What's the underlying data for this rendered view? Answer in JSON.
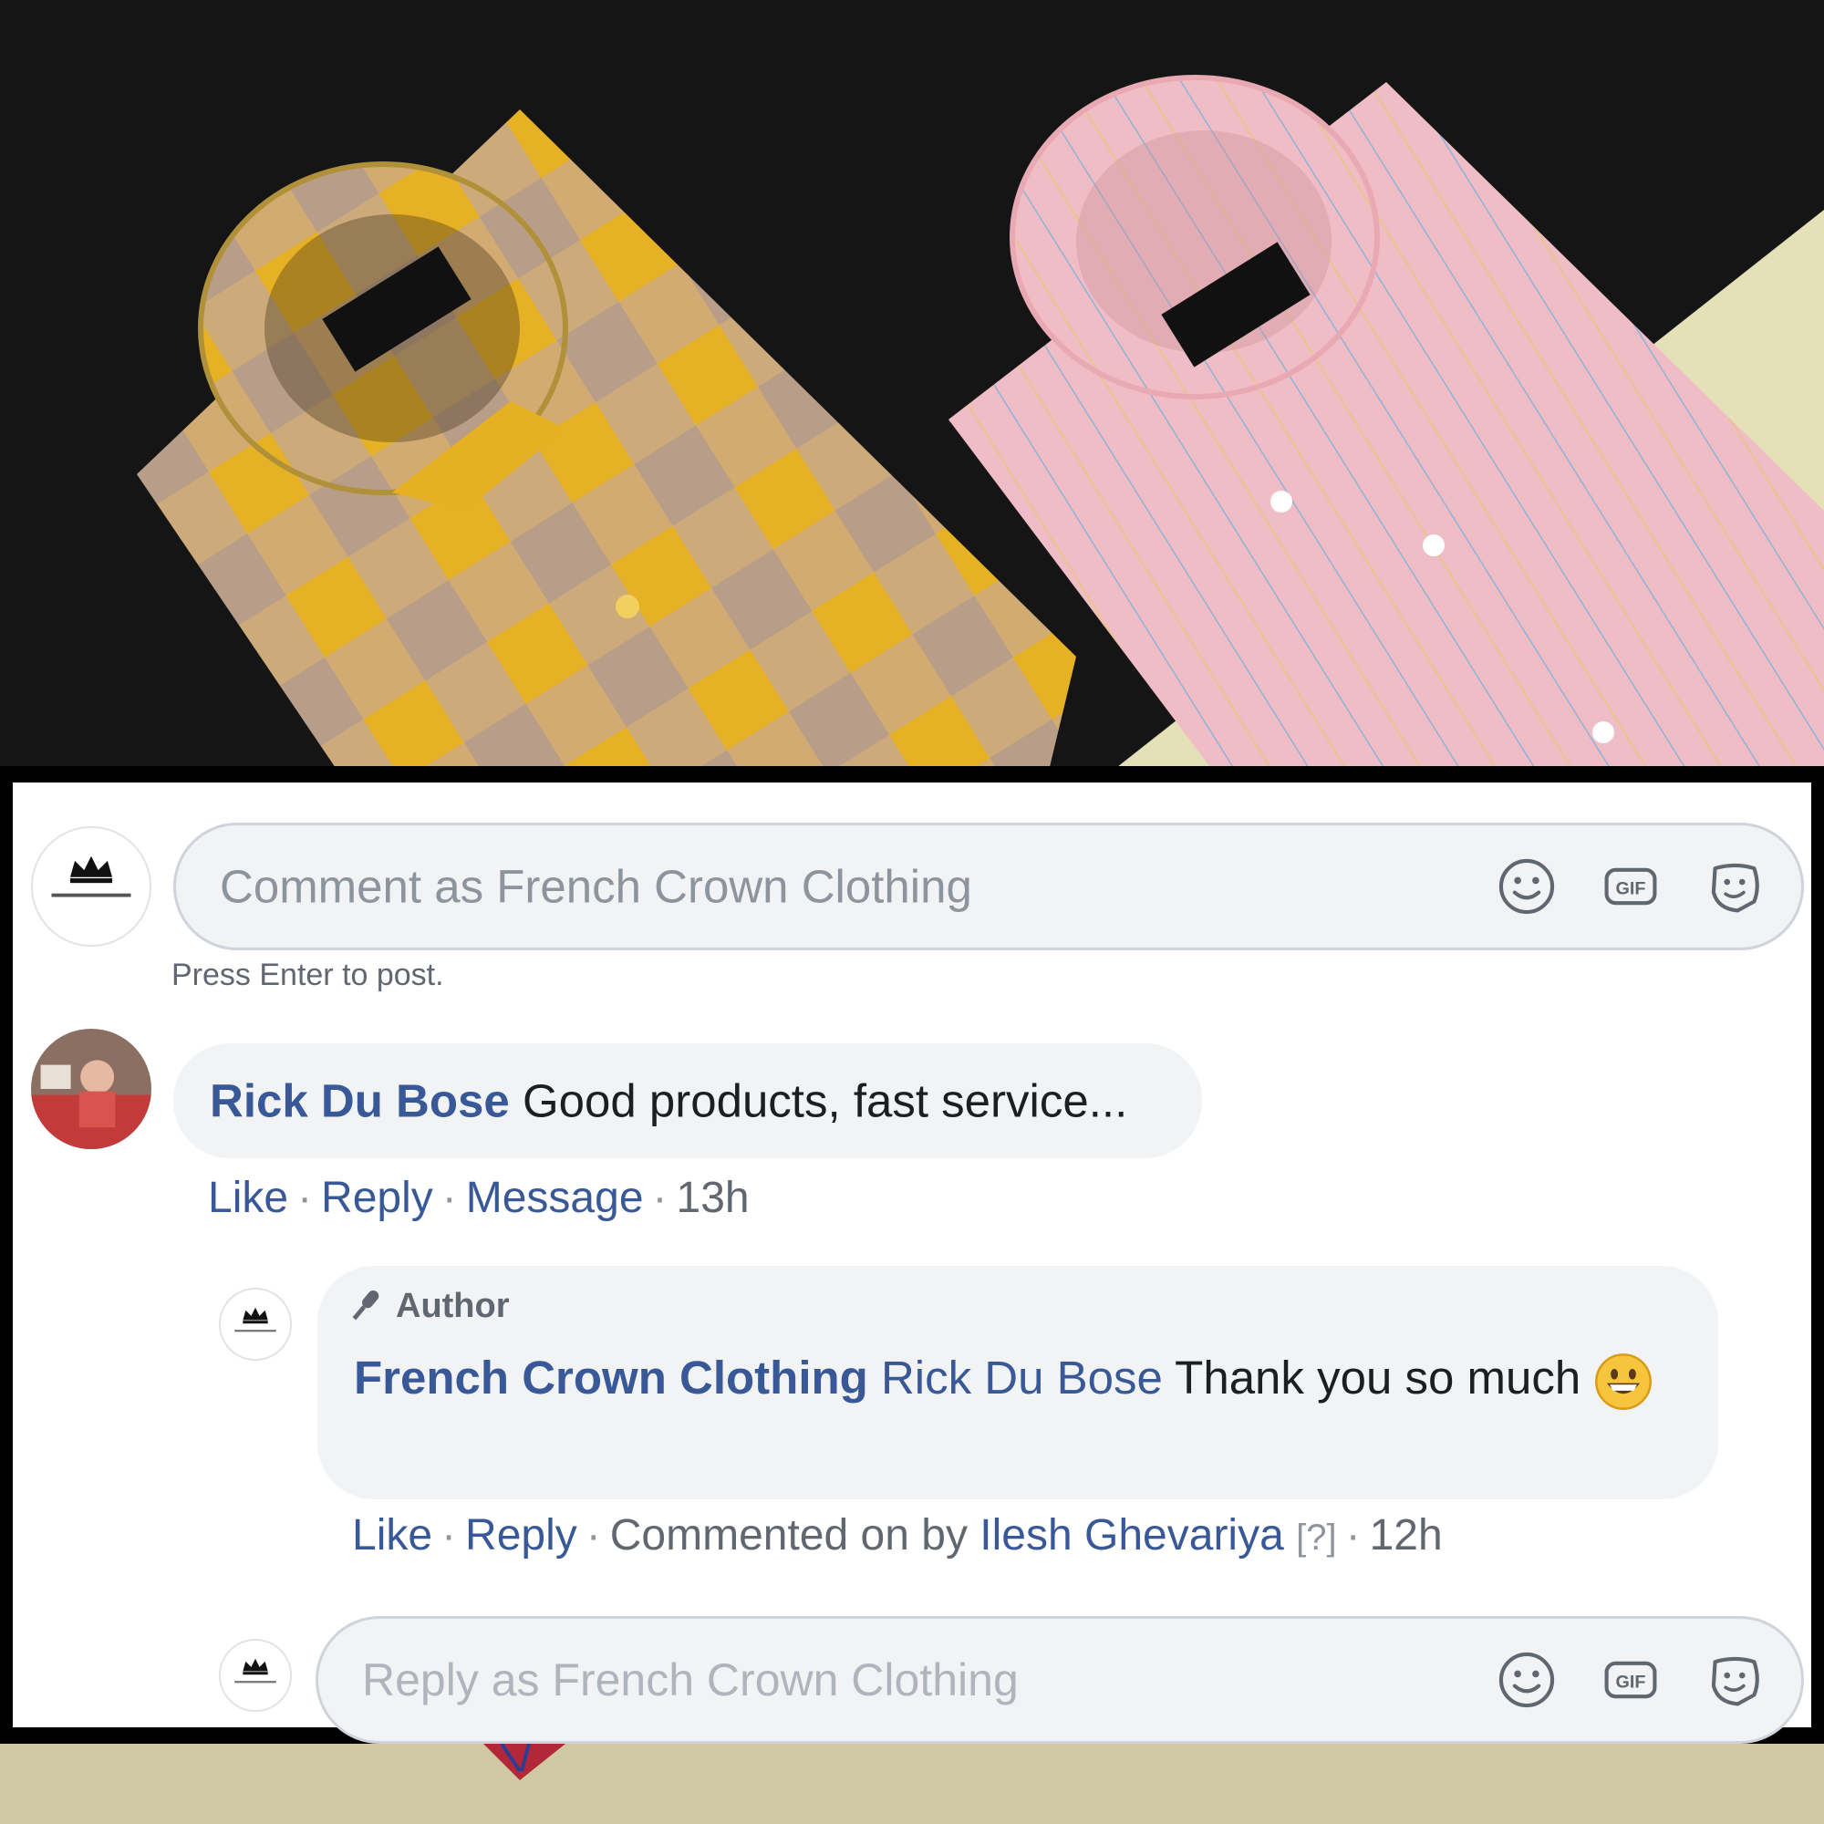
{
  "composer": {
    "placeholder": "Comment as French Crown Clothing",
    "hint": "Press Enter to post.",
    "icons": [
      "emoji-icon",
      "gif-icon",
      "sticker-icon"
    ]
  },
  "comment": {
    "author": "Rick Du Bose",
    "text": "Good products, fast service...",
    "actions": {
      "like": "Like",
      "reply": "Reply",
      "message": "Message",
      "time": "13h"
    }
  },
  "reply": {
    "badge": "Author",
    "author": "French Crown Clothing",
    "mention": "Rick Du Bose",
    "text": "Thank you so much",
    "emoji": "grinning-face",
    "actions": {
      "like": "Like",
      "reply": "Reply",
      "commented_by_prefix": "Commented on by",
      "commented_by_name": "Ilesh Ghevariya",
      "help": "[?]",
      "time": "12h"
    }
  },
  "reply_composer": {
    "placeholder": "Reply as French Crown Clothing"
  },
  "colors": {
    "link": "#385898",
    "bubble": "#f2f3f5",
    "meta": "#606770",
    "yellow_shirt": "#e2b02a",
    "pink_shirt": "#efbcc4"
  }
}
